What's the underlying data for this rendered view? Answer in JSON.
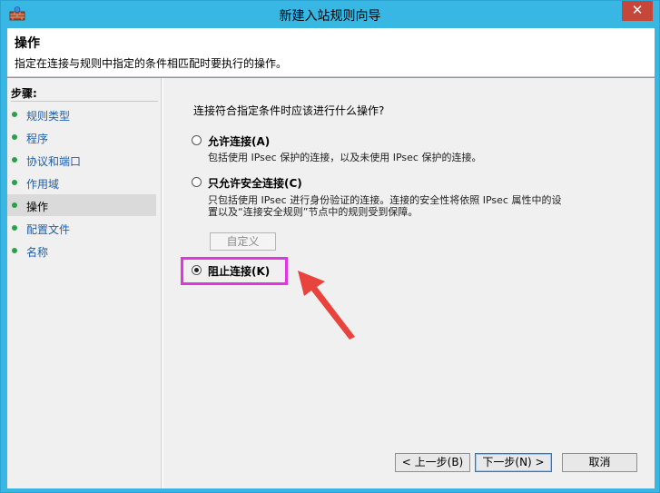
{
  "window": {
    "title": "新建入站规则向导",
    "close_glyph": "✕"
  },
  "header": {
    "title": "操作",
    "description": "指定在连接与规则中指定的条件相匹配时要执行的操作。"
  },
  "sidebar": {
    "heading": "步骤:",
    "steps": [
      {
        "label": "规则类型"
      },
      {
        "label": "程序"
      },
      {
        "label": "协议和端口"
      },
      {
        "label": "作用域"
      },
      {
        "label": "操作"
      },
      {
        "label": "配置文件"
      },
      {
        "label": "名称"
      }
    ],
    "active_step": "操作"
  },
  "content": {
    "question": "连接符合指定条件时应该进行什么操作?",
    "options": [
      {
        "label": "允许连接(A)",
        "description": "包括使用 IPsec 保护的连接，以及未使用 IPsec 保护的连接。",
        "selected": false
      },
      {
        "label": "只允许安全连接(C)",
        "description_line1": "只包括使用 IPsec 进行身份验证的连接。连接的安全性将依照 IPsec 属性中的设",
        "description_line2": "置以及“连接安全规则”节点中的规则受到保障。",
        "selected": false
      },
      {
        "label": "阻止连接(K)",
        "selected": true
      }
    ],
    "customize_button": "自定义"
  },
  "footer": {
    "back_button": "< 上一步(B)",
    "next_button": "下一步(N) >",
    "cancel_button": "取消"
  },
  "colors": {
    "title_bar": "#39b7e4",
    "highlight": "#e234e2",
    "arrow": "#e8433c",
    "step_dot": "#2aa04a",
    "link": "#1f5fa8"
  }
}
